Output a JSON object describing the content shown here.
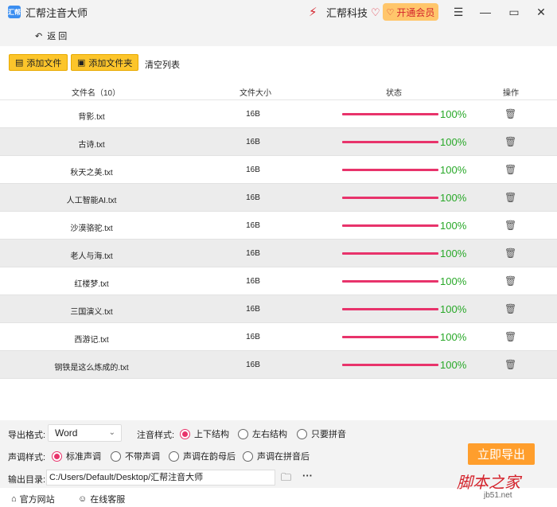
{
  "app": {
    "logo_text": "汇帮",
    "title": "汇帮注音大师",
    "brand_name": "汇帮科技",
    "vip_label": "开通会员"
  },
  "nav": {
    "back_label": "返 回"
  },
  "toolbar": {
    "add_file": "添加文件",
    "add_folder": "添加文件夹",
    "clear_list": "清空列表"
  },
  "table": {
    "headers": {
      "name": "文件名（10）",
      "size": "文件大小",
      "status": "状态",
      "action": "操作"
    },
    "rows": [
      {
        "name": "背影.txt",
        "size": "16B",
        "progress": "100%"
      },
      {
        "name": "古诗.txt",
        "size": "16B",
        "progress": "100%"
      },
      {
        "name": "秋天之美.txt",
        "size": "16B",
        "progress": "100%"
      },
      {
        "name": "人工智能AI.txt",
        "size": "16B",
        "progress": "100%"
      },
      {
        "name": "沙漠骆驼.txt",
        "size": "16B",
        "progress": "100%"
      },
      {
        "name": "老人与海.txt",
        "size": "16B",
        "progress": "100%"
      },
      {
        "name": "红楼梦.txt",
        "size": "16B",
        "progress": "100%"
      },
      {
        "name": "三国演义.txt",
        "size": "16B",
        "progress": "100%"
      },
      {
        "name": "西游记.txt",
        "size": "16B",
        "progress": "100%"
      },
      {
        "name": "钢铁是这么炼成的.txt",
        "size": "16B",
        "progress": "100%"
      }
    ]
  },
  "options": {
    "export_format_label": "导出格式:",
    "export_format_value": "Word",
    "annotation_style_label": "注音样式:",
    "annotation_styles": [
      "上下结构",
      "左右结构",
      "只要拼音"
    ],
    "tone_style_label": "声调样式:",
    "tone_styles": [
      "标准声调",
      "不带声调",
      "声调在韵母后",
      "声调在拼音后"
    ],
    "output_dir_label": "输出目录:",
    "output_dir": "C:/Users/Default/Desktop/汇帮注音大师",
    "export_button": "立即导出"
  },
  "footer": {
    "website": "官方网站",
    "support": "在线客服"
  },
  "watermark": {
    "main": "脚本之家",
    "sub": "jb51.net"
  },
  "colors": {
    "accent": "#e8336b",
    "progress_text": "#28a828",
    "toolbar_button": "#fcc52b",
    "export_button": "#ff9e2c"
  }
}
